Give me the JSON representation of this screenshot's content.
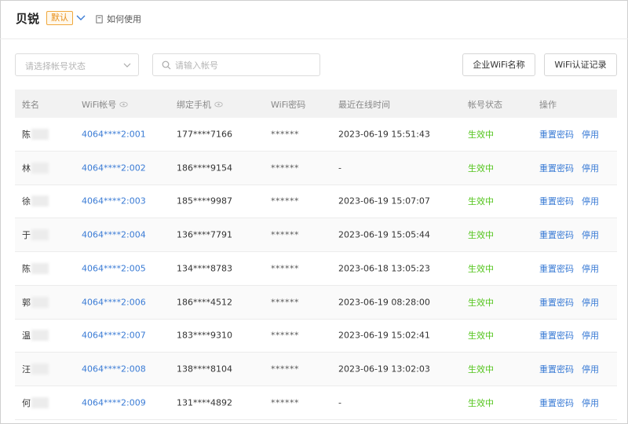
{
  "header": {
    "title": "贝锐",
    "badge": "默认",
    "help_label": "如何使用"
  },
  "filters": {
    "status_placeholder": "请选择帐号状态",
    "search_placeholder": "请输入帐号",
    "btn_wifi_name": "企业WiFi名称",
    "btn_auth_log": "WiFi认证记录"
  },
  "table": {
    "columns": {
      "name": "姓名",
      "account": "WiFi帐号",
      "phone": "绑定手机",
      "password": "WiFi密码",
      "last_online": "最近在线时间",
      "status": "帐号状态",
      "ops": "操作"
    },
    "rows": [
      {
        "name": "陈",
        "account": "4064****2:001",
        "phone": "177****7166",
        "password": "******",
        "last_online": "2023-06-19 15:51:43",
        "status": "生效中",
        "reset": "重置密码",
        "disable": "停用"
      },
      {
        "name": "林",
        "account": "4064****2:002",
        "phone": "186****9154",
        "password": "******",
        "last_online": "-",
        "status": "生效中",
        "reset": "重置密码",
        "disable": "停用"
      },
      {
        "name": "徐",
        "account": "4064****2:003",
        "phone": "185****9987",
        "password": "******",
        "last_online": "2023-06-19 15:07:07",
        "status": "生效中",
        "reset": "重置密码",
        "disable": "停用"
      },
      {
        "name": "于",
        "account": "4064****2:004",
        "phone": "136****7791",
        "password": "******",
        "last_online": "2023-06-19 15:05:44",
        "status": "生效中",
        "reset": "重置密码",
        "disable": "停用"
      },
      {
        "name": "陈",
        "account": "4064****2:005",
        "phone": "134****8783",
        "password": "******",
        "last_online": "2023-06-18 13:05:23",
        "status": "生效中",
        "reset": "重置密码",
        "disable": "停用"
      },
      {
        "name": "郭",
        "account": "4064****2:006",
        "phone": "186****4512",
        "password": "******",
        "last_online": "2023-06-19 08:28:00",
        "status": "生效中",
        "reset": "重置密码",
        "disable": "停用"
      },
      {
        "name": "温",
        "account": "4064****2:007",
        "phone": "183****9310",
        "password": "******",
        "last_online": "2023-06-19 15:02:41",
        "status": "生效中",
        "reset": "重置密码",
        "disable": "停用"
      },
      {
        "name": "汪",
        "account": "4064****2:008",
        "phone": "138****8104",
        "password": "******",
        "last_online": "2023-06-19 13:02:03",
        "status": "生效中",
        "reset": "重置密码",
        "disable": "停用"
      },
      {
        "name": "何",
        "account": "4064****2:009",
        "phone": "131****4892",
        "password": "******",
        "last_online": "-",
        "status": "生效中",
        "reset": "重置密码",
        "disable": "停用"
      }
    ]
  },
  "colors": {
    "link": "#3a7bd5",
    "status_active": "#52c41a",
    "badge": "#e8901a"
  },
  "icons": {
    "chevron": "chevron-down-icon",
    "help": "book-icon",
    "select_caret": "caret-down-icon",
    "search": "search-icon",
    "eye": "eye-icon"
  }
}
